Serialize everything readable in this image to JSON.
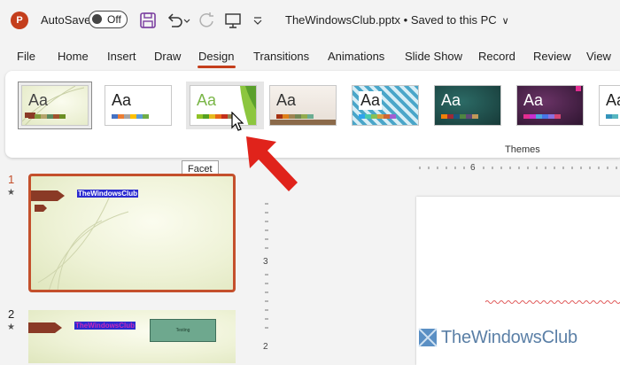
{
  "titlebar": {
    "app_logo": "P",
    "autosave_label": "AutoSave",
    "autosave_state": "Off",
    "file_title": "TheWindowsClub.pptx • Saved to this PC",
    "icons": [
      "save-icon",
      "undo-icon",
      "undo-dropdown-icon",
      "redo-icon",
      "present-icon",
      "customize-qat-icon",
      "chevron-down-icon"
    ]
  },
  "tabs": [
    {
      "label": "File"
    },
    {
      "label": "Home"
    },
    {
      "label": "Insert"
    },
    {
      "label": "Draw"
    },
    {
      "label": "Design"
    },
    {
      "label": "Transitions"
    },
    {
      "label": "Animations"
    },
    {
      "label": "Slide Show"
    },
    {
      "label": "Record"
    },
    {
      "label": "Review"
    },
    {
      "label": "View"
    }
  ],
  "active_tab": "Design",
  "themes": {
    "group_label": "Themes",
    "items": [
      {
        "label": "Aa",
        "aa_color": "#444444",
        "bg": "#f3f6e6",
        "swatches": [
          "#8a3a26",
          "#7f9a3c",
          "#b5a46b",
          "#5b8a5e",
          "#a0522d",
          "#6b8e23"
        ]
      },
      {
        "label": "Aa",
        "aa_color": "#222222",
        "bg": "#ffffff",
        "swatches": [
          "#4472c4",
          "#ed7d31",
          "#a5a5a5",
          "#ffc000",
          "#5b9bd5",
          "#70ad47"
        ]
      },
      {
        "label": "Aa",
        "aa_color": "#7ab648",
        "bg": "#ffffff",
        "swatches": [
          "#90c226",
          "#54a021",
          "#e6b91e",
          "#e76618",
          "#c42f1a",
          "#918655"
        ]
      },
      {
        "label": "Aa",
        "aa_color": "#333333",
        "bg": "#efe9e3",
        "swatches": [
          "#a53010",
          "#de7e18",
          "#9f8351",
          "#728653",
          "#92aa4c",
          "#6aac91"
        ]
      },
      {
        "label": "Aa",
        "aa_color": "#222222",
        "bg": "#bfe3ee",
        "swatches": [
          "#2fa3ee",
          "#4bcaad",
          "#86c157",
          "#d99c3f",
          "#ce6633",
          "#a35dd1"
        ]
      },
      {
        "label": "Aa",
        "aa_color": "#ffffff",
        "bg": "#1f4e4a",
        "swatches": [
          "#f07f09",
          "#9f2936",
          "#1b587c",
          "#4e8542",
          "#604878",
          "#c19859"
        ]
      },
      {
        "label": "Aa",
        "aa_color": "#ffffff",
        "bg": "#4a2448",
        "swatches": [
          "#e32d91",
          "#c830cc",
          "#4ea6dc",
          "#4775e7",
          "#8971e1",
          "#d54773"
        ]
      },
      {
        "label": "Aa",
        "aa_color": "#222222",
        "bg": "#ffffff",
        "swatches": [
          "#3494ba",
          "#58b6c0"
        ]
      }
    ]
  },
  "tooltip": "Facet",
  "slides": [
    {
      "number": "1",
      "title": "TheWindowsClub",
      "box_text": ""
    },
    {
      "number": "2",
      "title": "TheWindowsClub",
      "box_text": "Testing"
    }
  ],
  "ruler": {
    "h_label": "6",
    "v_label_1": "3",
    "v_label_2": "2"
  },
  "watermark": "TheWindowsClub",
  "colors": {
    "accent": "#c43e1c",
    "arrow": "#e0231b",
    "selected_border": "#c4502c"
  }
}
